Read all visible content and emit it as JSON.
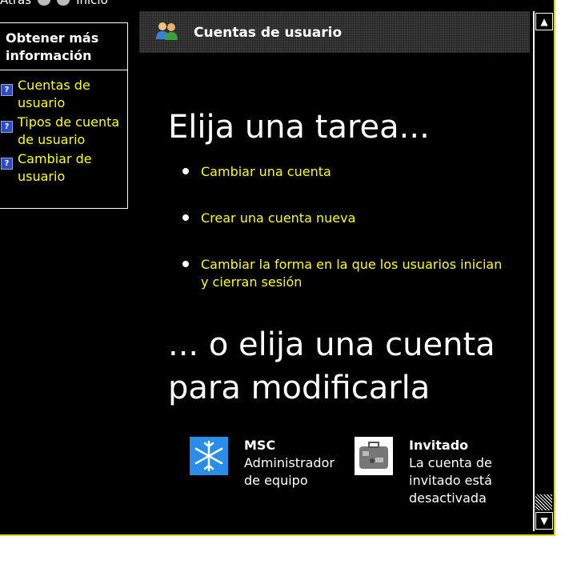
{
  "nav": {
    "back_label": "Atrás",
    "home_label": "Inicio"
  },
  "sidebar": {
    "title": "Obtener más información",
    "links": [
      {
        "label": "Cuentas de usuario"
      },
      {
        "label": "Tipos de cuenta de usuario"
      },
      {
        "label": "Cambiar de usuario"
      }
    ]
  },
  "header": {
    "title": "Cuentas de usuario",
    "icon": "users-icon"
  },
  "main": {
    "heading_tasks": "Elija una tarea...",
    "tasks": [
      {
        "label": "Cambiar una cuenta"
      },
      {
        "label": "Crear una cuenta nueva"
      },
      {
        "label": "Cambiar la forma en la que los usuarios inician y cierran sesión"
      }
    ],
    "heading_accounts": "... o elija una cuenta para modificarla",
    "accounts": [
      {
        "name": "MSC",
        "desc": "Administrador de equipo",
        "icon": "snowflake-icon"
      },
      {
        "name": "Invitado",
        "desc": "La cuenta de invitado está desactivada",
        "icon": "suitcase-icon"
      }
    ]
  },
  "colors": {
    "link": "#ffff00",
    "background": "#000000",
    "text": "#ffffff",
    "frame": "#d8d800"
  }
}
